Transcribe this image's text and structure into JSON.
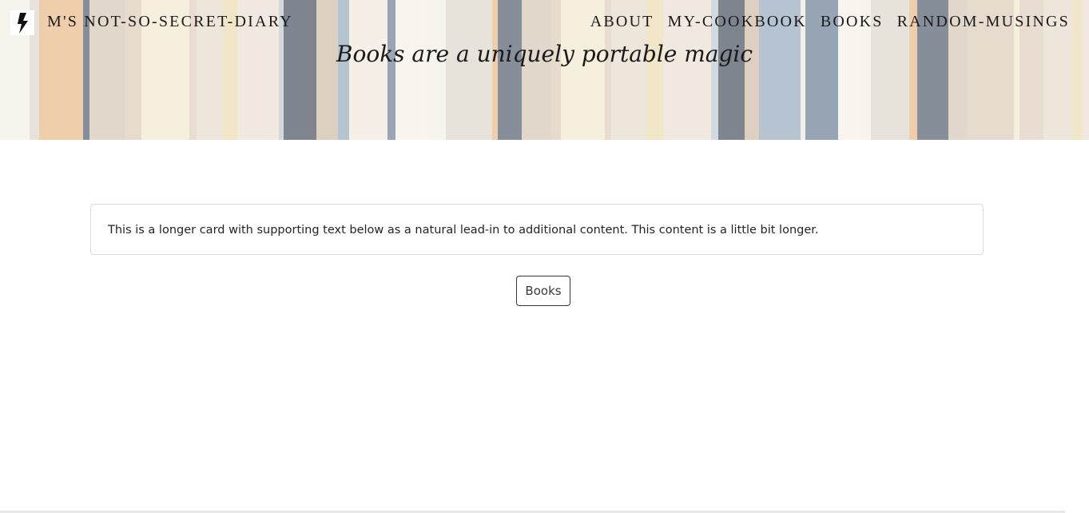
{
  "site": {
    "brand_name": "M'S NOT-SO-SECRET-DIARY",
    "logo_icon": "lightning-bolt-icon",
    "tagline": "Books are a uniquely portable magic"
  },
  "nav": {
    "links": [
      {
        "label": "ABOUT"
      },
      {
        "label": "MY-COOKBOOK"
      },
      {
        "label": "BOOKS"
      },
      {
        "label": "RANDOM-MUSINGS"
      }
    ]
  },
  "main": {
    "card_text": "This is a longer card with supporting text below as a natural lead-in to additional content. This content is a little bit longer.",
    "button_label": "Books"
  },
  "colors": {
    "text_dark": "#1a1a1a",
    "card_border": "#dcdcdc",
    "button_border": "#343a40"
  }
}
